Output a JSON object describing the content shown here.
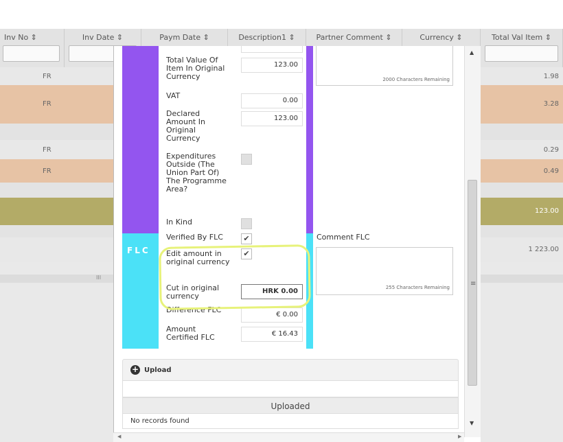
{
  "columns": [
    {
      "label": "Inv No ⇕"
    },
    {
      "label": "Inv Date ⇕"
    },
    {
      "label": "Paym Date ⇕"
    },
    {
      "label": "Description1 ⇕"
    },
    {
      "label": "Partner Comment ⇕"
    },
    {
      "label": "Currency ⇕"
    },
    {
      "label": "Total Val Item ⇕"
    }
  ],
  "background_rows": [
    {
      "inv_no": "FR",
      "total": "1.98",
      "color": "#e8e8e8"
    },
    {
      "inv_no": "FR",
      "total": "3.28",
      "color": "#e7c3a5"
    },
    {
      "inv_no": "FR",
      "total": "0.29",
      "color": "#e8e8e8"
    },
    {
      "inv_no": "FR",
      "total": "0.49",
      "color": "#e7c3a5"
    },
    {
      "inv_no": "",
      "total": "123.00",
      "color": "#b3ab67"
    },
    {
      "inv_no": "",
      "total": "1 223.00",
      "color": "#e8e8e8"
    }
  ],
  "form": {
    "total_value_label": "Total Value Of Item In Original Currency",
    "total_value": "123.00",
    "vat_label": "VAT",
    "vat_value": "0.00",
    "declared_label": "Declared Amount In Original Currency",
    "declared_value": "123.00",
    "expenditures_label": "Expenditures Outside (The Union Part Of) The Programme Area?",
    "in_kind_label": "In Kind",
    "verified_label": "Verified By FLC",
    "edit_amount_label": "Edit amount in original currency",
    "cut_label": "Cut in original currency",
    "cut_value": "HRK 0.00",
    "difference_label": "Difference FLC",
    "difference_value": "€ 0.00",
    "certified_label": "Amount Certified FLC",
    "certified_value": "€ 16.43",
    "check_mark": "✔",
    "partner_remaining": "2000 Characters Remaining",
    "comment_flc_label": "Comment FLC",
    "comment_remaining": "255 Characters Remaining",
    "flc_badge": "FLC"
  },
  "upload": {
    "button_label": "Upload",
    "plus_icon": "+",
    "uploaded_header": "Uploaded",
    "empty_text": "No records found"
  },
  "scroll": {
    "up": "▲",
    "down": "▼",
    "grip": "≡",
    "hgrip": "III",
    "left": "◀",
    "right": "▶"
  }
}
